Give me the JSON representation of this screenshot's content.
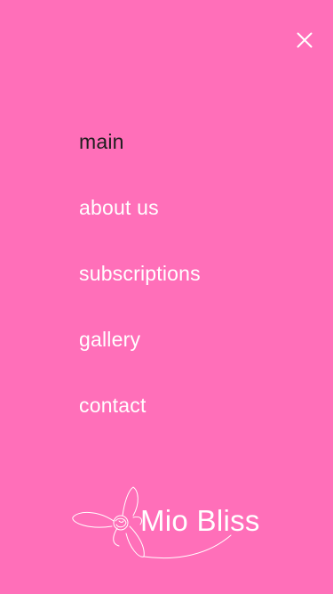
{
  "menu": {
    "close_icon": "close-icon",
    "items": [
      {
        "label": "main",
        "active": true
      },
      {
        "label": "about us",
        "active": false
      },
      {
        "label": "subscriptions",
        "active": false
      },
      {
        "label": "gallery",
        "active": false
      },
      {
        "label": "contact",
        "active": false
      }
    ]
  },
  "brand": {
    "name": "Mio Bliss",
    "icon": "orchid-flower-icon"
  },
  "colors": {
    "background": "#FF6FB9",
    "text": "#FFFFFF",
    "active_text": "#1E1E1E"
  }
}
